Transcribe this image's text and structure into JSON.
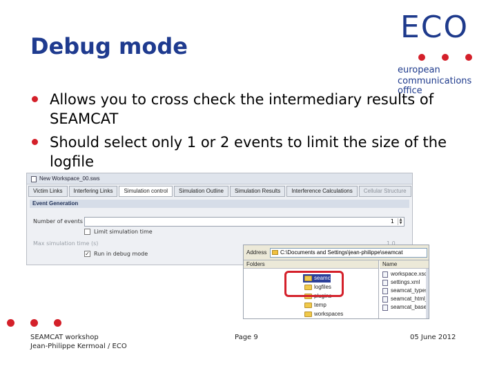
{
  "slide": {
    "title": "Debug mode",
    "bullets": [
      "Allows you to cross check the intermediary results of SEAMCAT",
      "Should select only 1 or 2 events to limit the size of the logfile"
    ]
  },
  "logo": {
    "word": "ECO",
    "lines": [
      "european",
      "communications",
      "office"
    ]
  },
  "app_window": {
    "title": "New Workspace_00.sws",
    "tabs": [
      {
        "label": "Victim Links"
      },
      {
        "label": "Interfering Links"
      },
      {
        "label": "Simulation control"
      },
      {
        "label": "Simulation Outline"
      },
      {
        "label": "Simulation Results"
      },
      {
        "label": "Interference Calculations"
      },
      {
        "label": "Cellular Structure"
      }
    ],
    "panel_heading": "Event Generation",
    "number_of_events_label": "Number of events",
    "number_of_events_value": "1",
    "limit_simulation_time_label": "Limit simulation time",
    "max_time_label": "Max simulation time (s)",
    "max_time_value": "1.0",
    "debug_mode_label": "Run in debug mode"
  },
  "explorer": {
    "address_label": "Address",
    "address_path": "C:\\Documents and Settings\\jean-philippe\\seamcat",
    "folders_header": "Folders",
    "folders": [
      "seamcat",
      "logfiles",
      "plugins",
      "temp",
      "workspaces"
    ],
    "name_header": "Name",
    "files": [
      "workspace.xsd",
      "settings.xml",
      "seamcat_types",
      "seamcat_html_b",
      "seamcat_base_f"
    ]
  },
  "footer": {
    "left_line1": "SEAMCAT workshop",
    "left_line2": "Jean-Philippe Kermoal / ECO",
    "center": "Page 9",
    "right": "05 June 2012"
  },
  "colors": {
    "title": "#1f3b8f",
    "accent_red": "#d4202a",
    "logo_blue": "#1e3a8c"
  }
}
